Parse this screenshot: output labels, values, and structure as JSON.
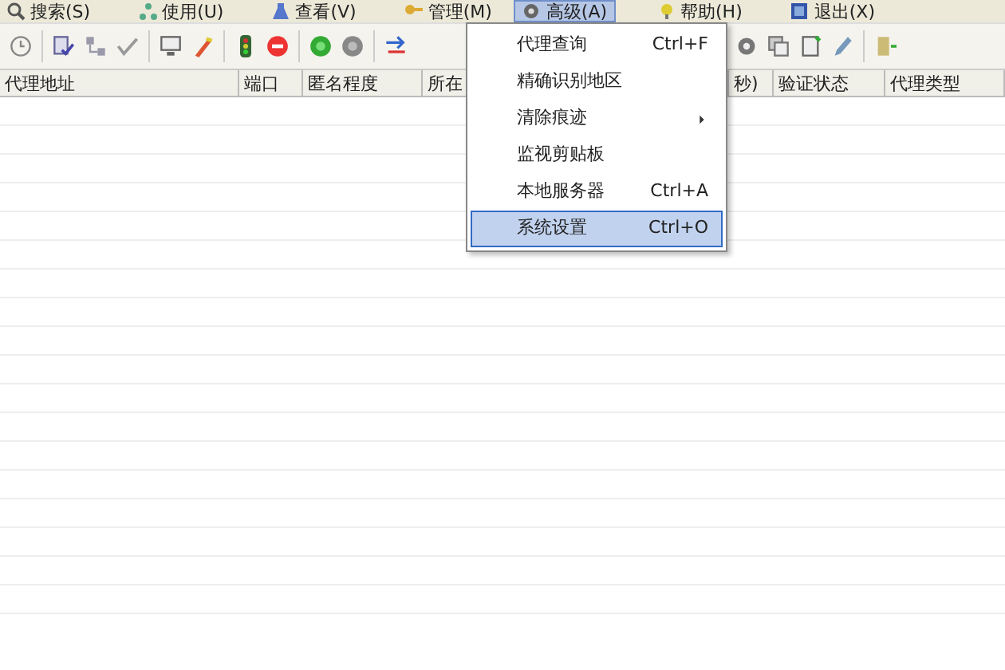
{
  "menu_bar": [
    {
      "label": "搜索(S)",
      "selected": false
    },
    {
      "label": "使用(U)",
      "selected": false
    },
    {
      "label": "查看(V)",
      "selected": false
    },
    {
      "label": "管理(M)",
      "selected": false
    },
    {
      "label": "高级(A)",
      "selected": true
    },
    {
      "label": "帮助(H)",
      "selected": false
    },
    {
      "label": "退出(X)",
      "selected": false
    }
  ],
  "dropdown_menu": [
    {
      "label": "代理查询",
      "shortcut": "Ctrl+F",
      "submenu": false,
      "selected": false
    },
    {
      "label": "精确识别地区",
      "submenu": false,
      "selected": false
    },
    {
      "label": "清除痕迹",
      "submenu": true,
      "selected": false
    },
    {
      "label": "监视剪贴板",
      "submenu": false,
      "selected": false
    },
    {
      "label": "本地服务器",
      "shortcut": "Ctrl+A",
      "submenu": false,
      "selected": false
    },
    {
      "label": "系统设置",
      "shortcut": "Ctrl+O",
      "submenu": false,
      "selected": true
    }
  ],
  "table": {
    "columns": [
      "代理地址",
      "端口",
      "匿名程度",
      "所在",
      "秒)",
      "验证状态",
      "代理类型"
    ]
  }
}
